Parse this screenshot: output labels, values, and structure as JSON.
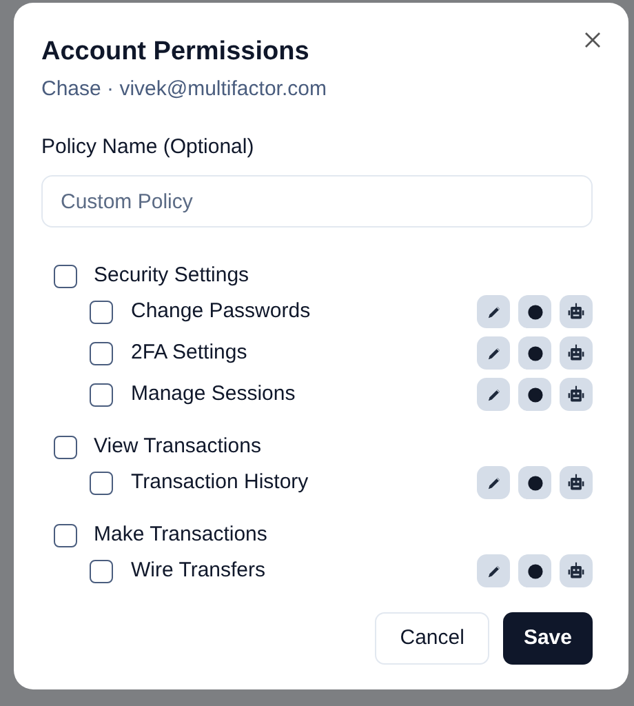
{
  "dialog": {
    "title": "Account Permissions",
    "subtitle": "Chase · vivek@multifactor.com"
  },
  "policy_name": {
    "label": "Policy Name (Optional)",
    "placeholder": "Custom Policy"
  },
  "groups": [
    {
      "label": "Security Settings",
      "checked": false,
      "children": [
        {
          "label": "Change Passwords",
          "checked": false
        },
        {
          "label": "2FA Settings",
          "checked": false
        },
        {
          "label": "Manage Sessions",
          "checked": false
        }
      ]
    },
    {
      "label": "View Transactions",
      "checked": false,
      "children": [
        {
          "label": "Transaction History",
          "checked": false
        }
      ]
    },
    {
      "label": "Make Transactions",
      "checked": false,
      "children": [
        {
          "label": "Wire Transfers",
          "checked": false
        }
      ]
    }
  ],
  "buttons": [
    {
      "label": "Cancel",
      "kind": "secondary"
    },
    {
      "label": "Save",
      "kind": "primary"
    }
  ]
}
